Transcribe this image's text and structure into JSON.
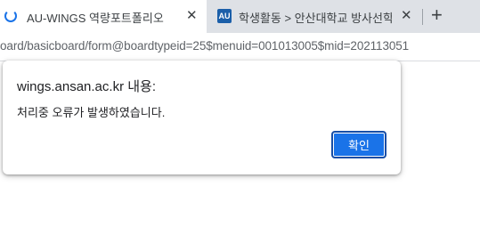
{
  "tabs": [
    {
      "title": "AU-WINGS 역량포트폴리오",
      "close_glyph": "✕",
      "icon": "loading-spinner-icon",
      "active": true
    },
    {
      "title": "학생활동 > 안산대학교 방사선학",
      "close_glyph": "✕",
      "icon": "au-favicon",
      "favicon_text": "AU",
      "active": false
    }
  ],
  "new_tab_glyph": "+",
  "address_bar": {
    "url_text": "oard/basicboard/form@boardtypeid=25$menuid=001013005$mid=202113051"
  },
  "dialog": {
    "title": "wings.ansan.ac.kr 내용:",
    "message": "처리중 오류가 발생하였습니다.",
    "ok_label": "확인"
  },
  "colors": {
    "accent": "#1a73e8",
    "tabstrip_bg": "#dee1e6",
    "au_favicon_bg": "#1b5fa9"
  }
}
